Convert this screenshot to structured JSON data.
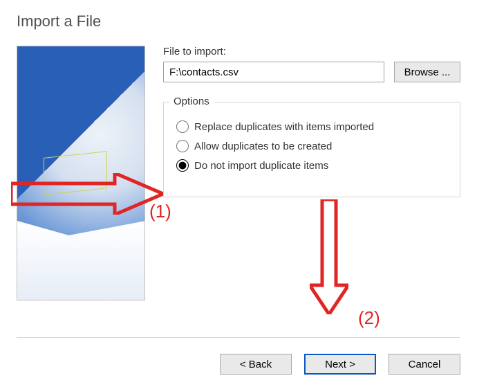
{
  "dialog": {
    "title": "Import a File",
    "file_label": "File to import:",
    "file_path": "F:\\contacts.csv",
    "browse_label": "Browse ...",
    "options": {
      "legend": "Options",
      "replace": "Replace duplicates with items imported",
      "allow": "Allow duplicates to be created",
      "no_import": "Do not import duplicate items",
      "selected": "no_import"
    },
    "buttons": {
      "back": "< Back",
      "next": "Next >",
      "cancel": "Cancel"
    }
  },
  "annotations": {
    "label1": "(1)",
    "label2": "(2)"
  }
}
